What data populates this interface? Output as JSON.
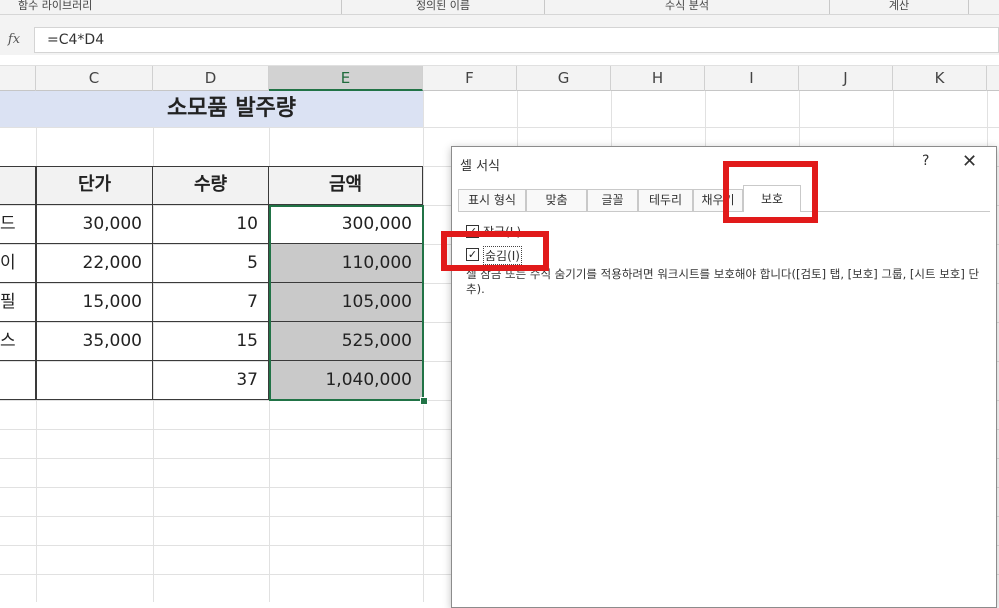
{
  "ribbon": {
    "groups": [
      "함수 라이브러리",
      "정의된 이름",
      "수식 분석",
      "계산"
    ]
  },
  "formula_bar": {
    "fx_label": "fx",
    "formula": "=C4*D4"
  },
  "columns": [
    "C",
    "D",
    "E",
    "F",
    "G",
    "H",
    "I",
    "J",
    "K"
  ],
  "selected_column": "E",
  "sheet": {
    "title": "소모품 발주량",
    "headers": {
      "price": "단가",
      "qty": "수량",
      "amount": "금액"
    },
    "rows": [
      {
        "name_tail": "드",
        "price": "30,000",
        "qty": "10",
        "amount": "300,000"
      },
      {
        "name_tail": "이",
        "price": "22,000",
        "qty": "5",
        "amount": "110,000"
      },
      {
        "name_tail": "필",
        "price": "15,000",
        "qty": "7",
        "amount": "105,000"
      },
      {
        "name_tail": "스",
        "price": "35,000",
        "qty": "15",
        "amount": "525,000"
      }
    ],
    "total": {
      "qty": "37",
      "amount": "1,040,000"
    }
  },
  "dialog": {
    "title": "셀 서식",
    "help": "?",
    "close": "✕",
    "tabs": [
      "표시 형식",
      "맞춤",
      "글꼴",
      "테두리",
      "채우기",
      "보호"
    ],
    "active_tab": "보호",
    "lock_label": "잠금(L)",
    "lock_checked": true,
    "hide_label": "숨김(I)",
    "hide_checked": true,
    "note": "셀 잠금 또는 수식 숨기기를 적용하려면 워크시트를 보호해야 합니다([검토] 탭, [보호] 그룹, [시트 보호] 단추)."
  },
  "colors": {
    "accent": "#217346",
    "highlight": "#e11a1a",
    "title_fill": "#dbe2f3",
    "selected_fill": "#c9c9c9"
  }
}
